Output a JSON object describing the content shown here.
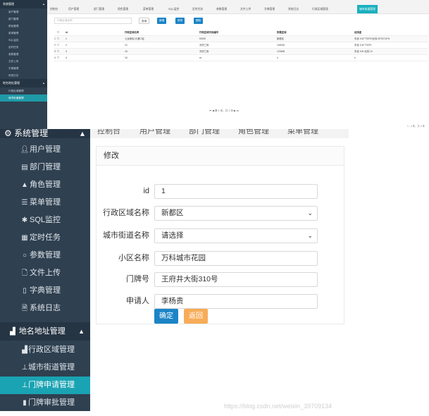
{
  "top_screenshot": {
    "sidebar": {
      "system_group": "系统管理",
      "items": [
        "用户管理",
        "部门管理",
        "角色管理",
        "菜单管理",
        "SQL监控",
        "定时任务",
        "参数管理",
        "文件上传",
        "字典管理",
        "系统日志"
      ],
      "geo_group": "地名地址管理",
      "geo_items": [
        "行政区域管理",
        "城市街道管理"
      ]
    },
    "tabs": [
      "控制台",
      "用户管理",
      "部门管理",
      "角色管理",
      "菜单管理",
      "SQL监控",
      "定时任务",
      "参数管理",
      "文件上传",
      "字典管理",
      "系统日志",
      "行政区域管理",
      "城市街道管理"
    ],
    "active_tab": "城市街道管理",
    "toolbar": {
      "search_placeholder": "行政区域名称",
      "query": "查询",
      "add": "新增",
      "edit": "修改",
      "delete": "删除"
    },
    "table": {
      "headers": [
        "id",
        "行政区域名称",
        "行政区域代码编号",
        "所属区域",
        "经纬度"
      ],
      "rows": [
        [
          "1",
          "九龙坡区/大渡口区",
          "50000",
          "新都区",
          "东经 104°7′53″E/北纬 30°52′24″N"
        ],
        [
          "2",
          "12",
          "天府三街",
          "100016",
          "天府新区"
        ],
        [
          "3",
          "16",
          "天府三街",
          "123456",
          "天府新区"
        ],
        [
          "4",
          "16",
          "ss",
          "s",
          "天府新区"
        ]
      ]
    },
    "pager": "第 1 页，共 1 页",
    "pager_right": "1 - 4 条，共 4 条"
  },
  "bottom_screenshot": {
    "sidebar": {
      "system_group": "系统管理",
      "items": [
        {
          "label": "用户管理",
          "icon": "user-icon"
        },
        {
          "label": "部门管理",
          "icon": "building-icon"
        },
        {
          "label": "角色管理",
          "icon": "role-icon"
        },
        {
          "label": "菜单管理",
          "icon": "list-icon"
        },
        {
          "label": "SQL监控",
          "icon": "bug-icon"
        },
        {
          "label": "定时任务",
          "icon": "tasks-icon"
        },
        {
          "label": "参数管理",
          "icon": "circle-icon"
        },
        {
          "label": "文件上传",
          "icon": "file-upload-icon"
        },
        {
          "label": "字典管理",
          "icon": "book-icon"
        },
        {
          "label": "系统日志",
          "icon": "file-text-icon"
        }
      ],
      "geo_group": "地名地址管理",
      "geo_items": [
        {
          "label": "行政区域管理",
          "icon": "area-chart-icon"
        },
        {
          "label": "城市街道管理",
          "icon": "user-pin-icon"
        },
        {
          "label": "门牌申请管理",
          "icon": "user-pin-icon"
        },
        {
          "label": "门牌审批管理",
          "icon": "book-icon"
        }
      ],
      "active_item": "门牌申请管理"
    },
    "tabs_partial": [
      "控制台",
      "用户管理",
      "部门管理",
      "角色管理",
      "菜单管理"
    ],
    "panel_title": "修改",
    "form": {
      "id": {
        "label": "id",
        "value": "1"
      },
      "district": {
        "label": "行政区域名称",
        "value": "新都区"
      },
      "street": {
        "label": "城市街道名称",
        "value": "请选择"
      },
      "community": {
        "label": "小区名称",
        "value": "万科城市花园"
      },
      "door_no": {
        "label": "门牌号",
        "value": "王府井大街310号"
      },
      "applicant": {
        "label": "申请人",
        "value": "李杨贵"
      }
    },
    "buttons": {
      "confirm": "确定",
      "back": "返回"
    },
    "colors": {
      "sidebar_bg": "#2f4050",
      "active_item": "#1aa3b3",
      "confirm_btn": "#1c84c6",
      "back_btn": "#f8ac59"
    },
    "watermark": "https://blog.csdn.net/weixin_39709134"
  }
}
